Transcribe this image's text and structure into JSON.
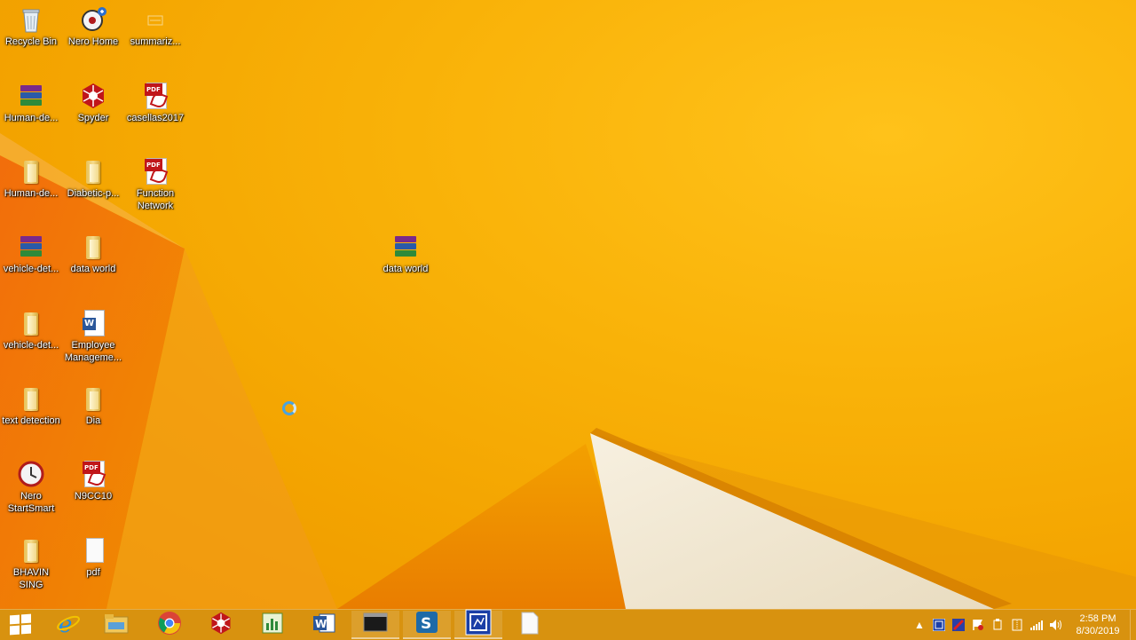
{
  "desktop": {
    "icons": [
      {
        "label": "Recycle Bin",
        "icon": "recycle-bin-icon"
      },
      {
        "label": "Nero Home",
        "icon": "nero-home-icon"
      },
      {
        "label": "summariz...",
        "icon": "document-icon"
      },
      {
        "label": "Human-de...",
        "icon": "winrar-archive-icon"
      },
      {
        "label": "Spyder",
        "icon": "spyder-icon"
      },
      {
        "label": "casellas2017",
        "icon": "pdf-icon"
      },
      {
        "label": "Human-de...",
        "icon": "folder-icon"
      },
      {
        "label": "Diabetic-p...",
        "icon": "folder-icon"
      },
      {
        "label": "Function Network",
        "icon": "pdf-icon"
      },
      {
        "label": "vehicle-det...",
        "icon": "winrar-archive-icon"
      },
      {
        "label": "data world",
        "icon": "folder-icon"
      },
      {
        "label": "data world",
        "icon": "winrar-archive-icon"
      },
      {
        "label": "vehicle-det...",
        "icon": "folder-icon"
      },
      {
        "label": "Employee Manageme...",
        "icon": "word-document-icon"
      },
      {
        "label": "text detection",
        "icon": "folder-icon"
      },
      {
        "label": "Dia",
        "icon": "folder-icon"
      },
      {
        "label": "Nero StartSmart",
        "icon": "nero-startsmart-icon"
      },
      {
        "label": "N9CC10",
        "icon": "pdf-icon"
      },
      {
        "label": "BHAVIN SING",
        "icon": "folder-icon"
      },
      {
        "label": "pdf",
        "icon": "blank-file-icon"
      }
    ]
  },
  "taskbar": {
    "pinned": [
      {
        "name": "start-button",
        "icon": "windows-logo-icon"
      },
      {
        "name": "internet-explorer",
        "icon": "internet-explorer-icon"
      },
      {
        "name": "file-explorer",
        "icon": "folder-icon"
      },
      {
        "name": "chrome",
        "icon": "chrome-icon"
      },
      {
        "name": "spyder",
        "icon": "spyder-icon"
      },
      {
        "name": "chart-app",
        "icon": "chart-icon"
      },
      {
        "name": "word",
        "icon": "word-icon"
      },
      {
        "name": "command-prompt",
        "icon": "terminal-icon"
      },
      {
        "name": "snagit",
        "icon": "snagit-icon"
      },
      {
        "name": "screen-recorder",
        "icon": "recorder-icon"
      },
      {
        "name": "notepad",
        "icon": "blank-file-icon"
      }
    ],
    "tray": {
      "time": "2:58 PM",
      "date": "8/30/2019"
    }
  }
}
